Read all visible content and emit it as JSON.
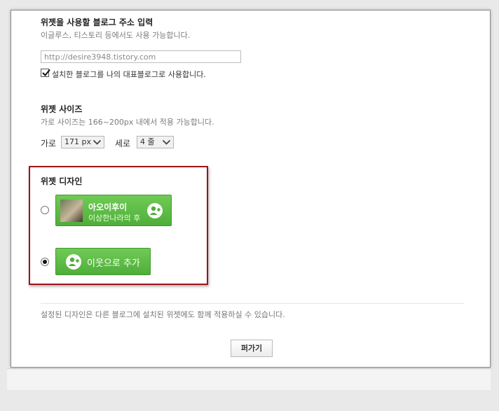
{
  "blog_address": {
    "title": "위젯을 사용할 블로그 주소 입력",
    "description": "이글루스, 티스토리 등에서도 사용 가능합니다.",
    "url_value": "http://desire3948.tistory.com",
    "set_representative_label": "설치한 블로그를 나의 대표블로그로 사용합니다.",
    "set_representative_checked": true
  },
  "widget_size": {
    "title": "위젯 사이즈",
    "description": "가로 사이즈는 166~200px 내에서 적용 가능합니다.",
    "width_label": "가로",
    "width_value": "171 px",
    "height_label": "세로",
    "height_value": "4 줄"
  },
  "widget_design": {
    "title": "위젯 디자인",
    "option_profile": {
      "selected": false,
      "name": "아오이후이",
      "subtitle": "이상한나라의 후"
    },
    "option_simple": {
      "selected": true,
      "label": "이웃으로 추가"
    }
  },
  "footer": {
    "note": "설정된 디자인은 다른 블로그에 설치된 위젯에도 함께 적용하실 수 있습니다.",
    "confirm_label": "퍼가기"
  },
  "colors": {
    "accent_green": "#5bbb45",
    "highlight_red": "#a0121a"
  },
  "icons": {
    "checkbox": "check-icon",
    "dropdown": "chevron-down-icon",
    "add_neighbor": "add-person-icon"
  }
}
